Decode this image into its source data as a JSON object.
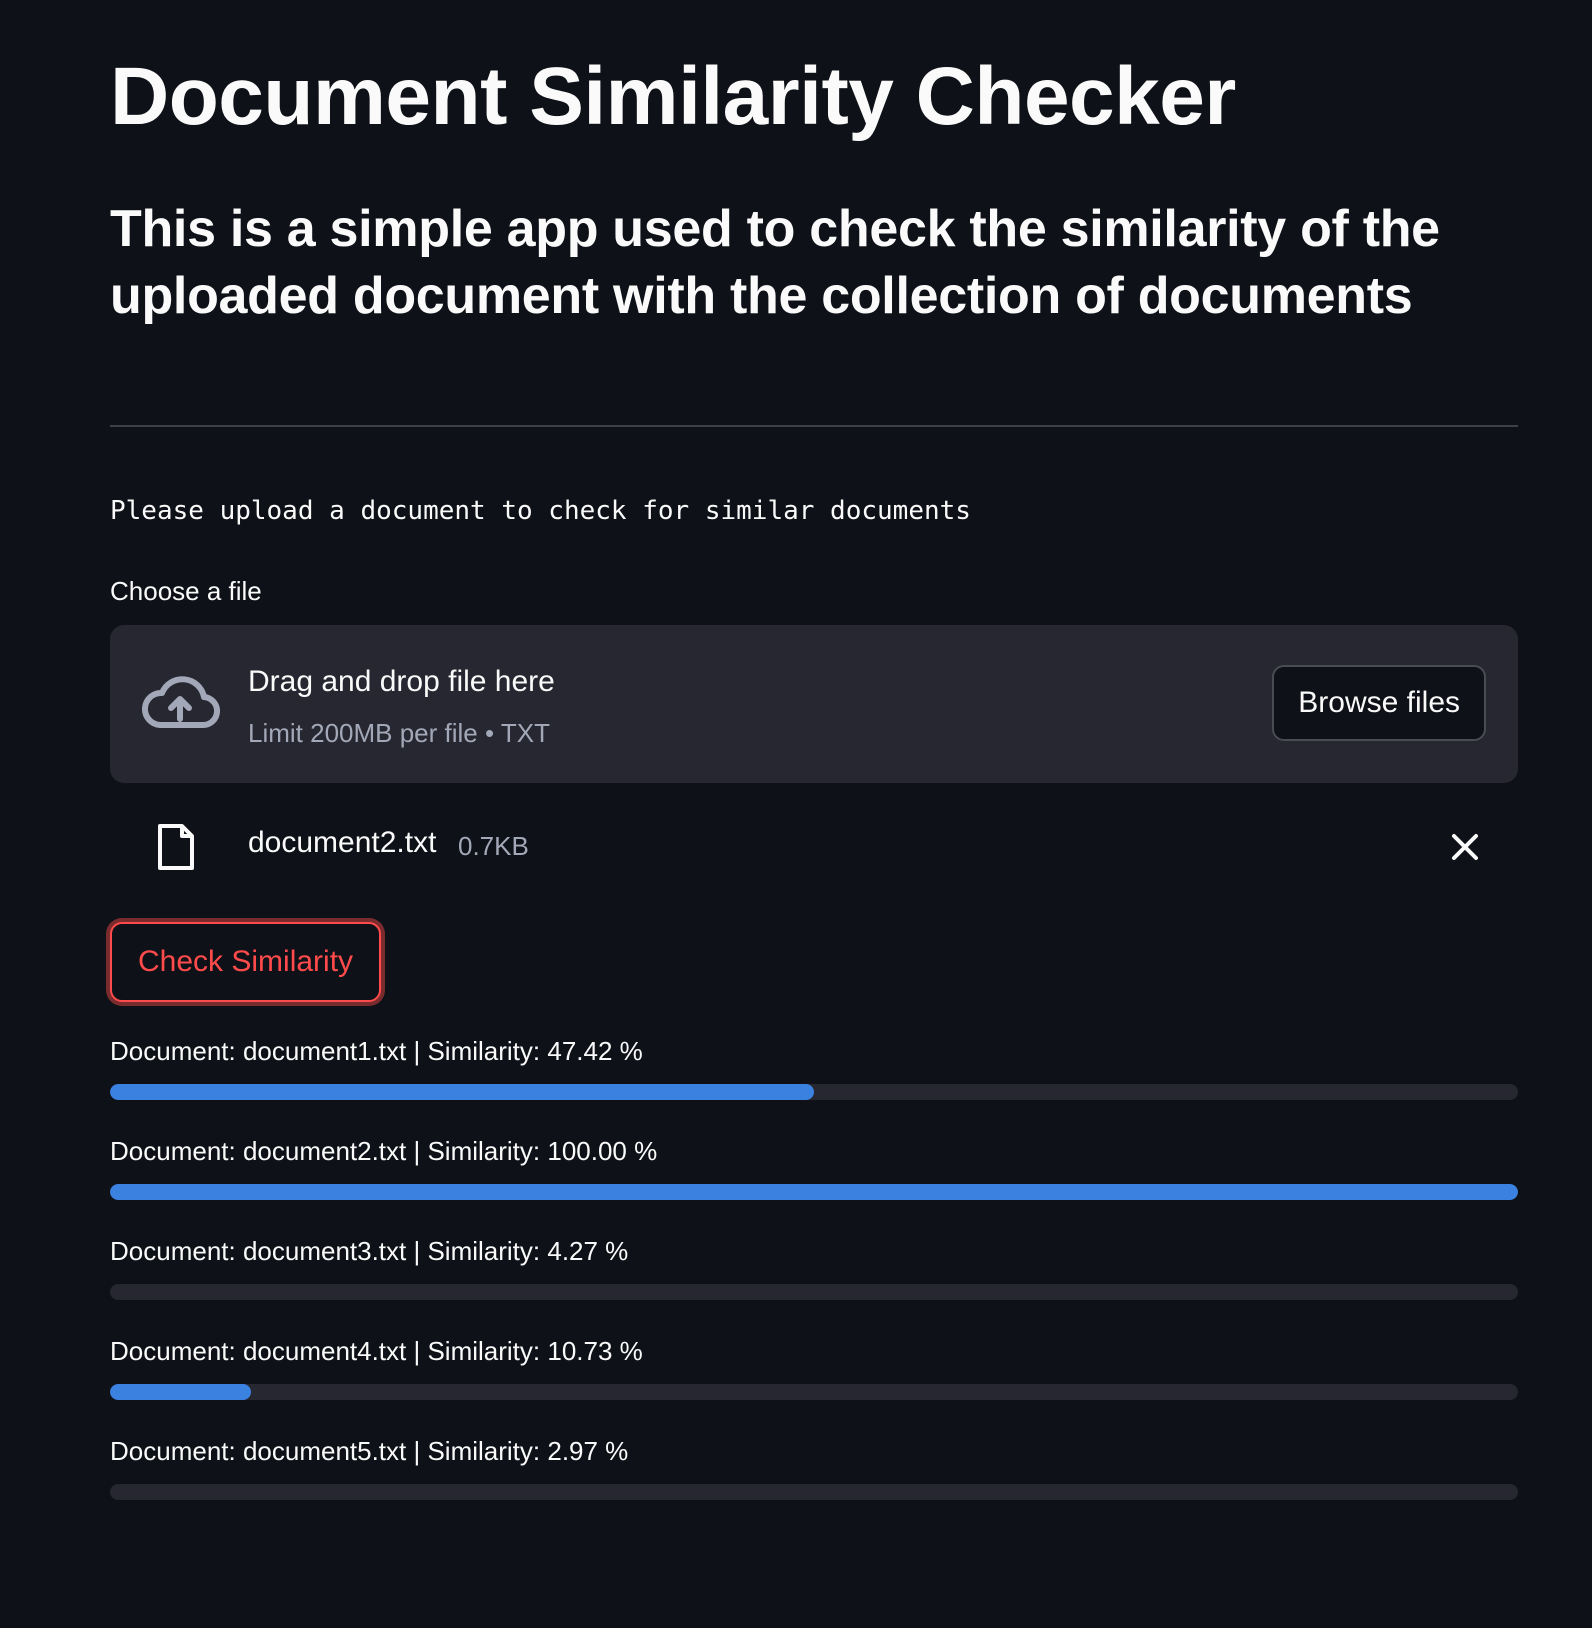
{
  "header": {
    "title": "Document Similarity Checker",
    "subtitle": "This is a simple app used to check the similarity of the uploaded document with the collection of documents"
  },
  "upload": {
    "prompt": "Please upload a document to check for similar documents",
    "label": "Choose a file",
    "drop_text": "Drag and drop file here",
    "limit_text": "Limit 200MB per file • TXT",
    "browse_label": "Browse files",
    "icon": "cloud-upload-icon"
  },
  "uploaded_file": {
    "name": "document2.txt",
    "size": "0.7KB",
    "icon": "file-icon",
    "remove_icon": "close-icon"
  },
  "actions": {
    "check_label": "Check Similarity"
  },
  "colors": {
    "background": "#0e1117",
    "accent_red": "#ff4b4b",
    "progress_blue": "#3b82e0",
    "track": "#262730"
  },
  "results": [
    {
      "label": "Document: document1.txt | Similarity: 47.42 %",
      "value": 0.5
    },
    {
      "label": "Document: document2.txt | Similarity: 100.00 %",
      "value": 1.0
    },
    {
      "label": "Document: document3.txt | Similarity: 4.27 %",
      "value": 0.0
    },
    {
      "label": "Document: document4.txt | Similarity: 10.73 %",
      "value": 0.1
    },
    {
      "label": "Document: document5.txt | Similarity: 2.97 %",
      "value": 0.0
    }
  ]
}
